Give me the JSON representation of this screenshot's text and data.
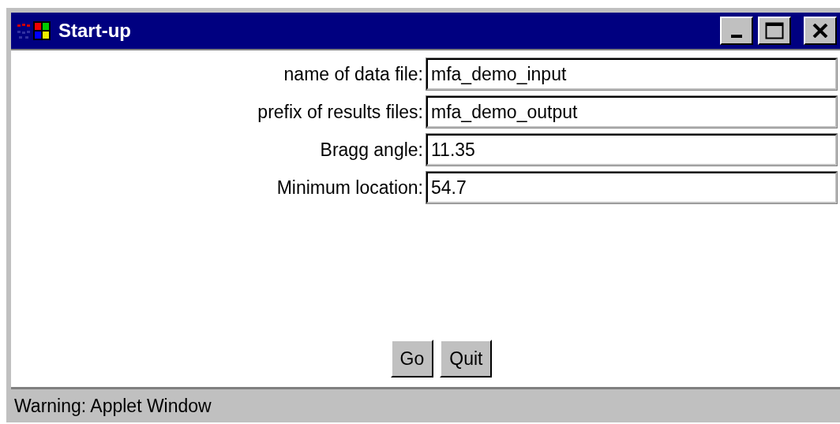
{
  "window": {
    "title": "Start-up"
  },
  "fields": [
    {
      "label": "name of data file:",
      "value": "mfa_demo_input"
    },
    {
      "label": "prefix of results files:",
      "value": "mfa_demo_output"
    },
    {
      "label": "Bragg angle:",
      "value": "11.35"
    },
    {
      "label": "Minimum location:",
      "value": "54.7"
    }
  ],
  "buttons": [
    "Go",
    "Quit"
  ],
  "status_bar": "Warning: Applet Window"
}
